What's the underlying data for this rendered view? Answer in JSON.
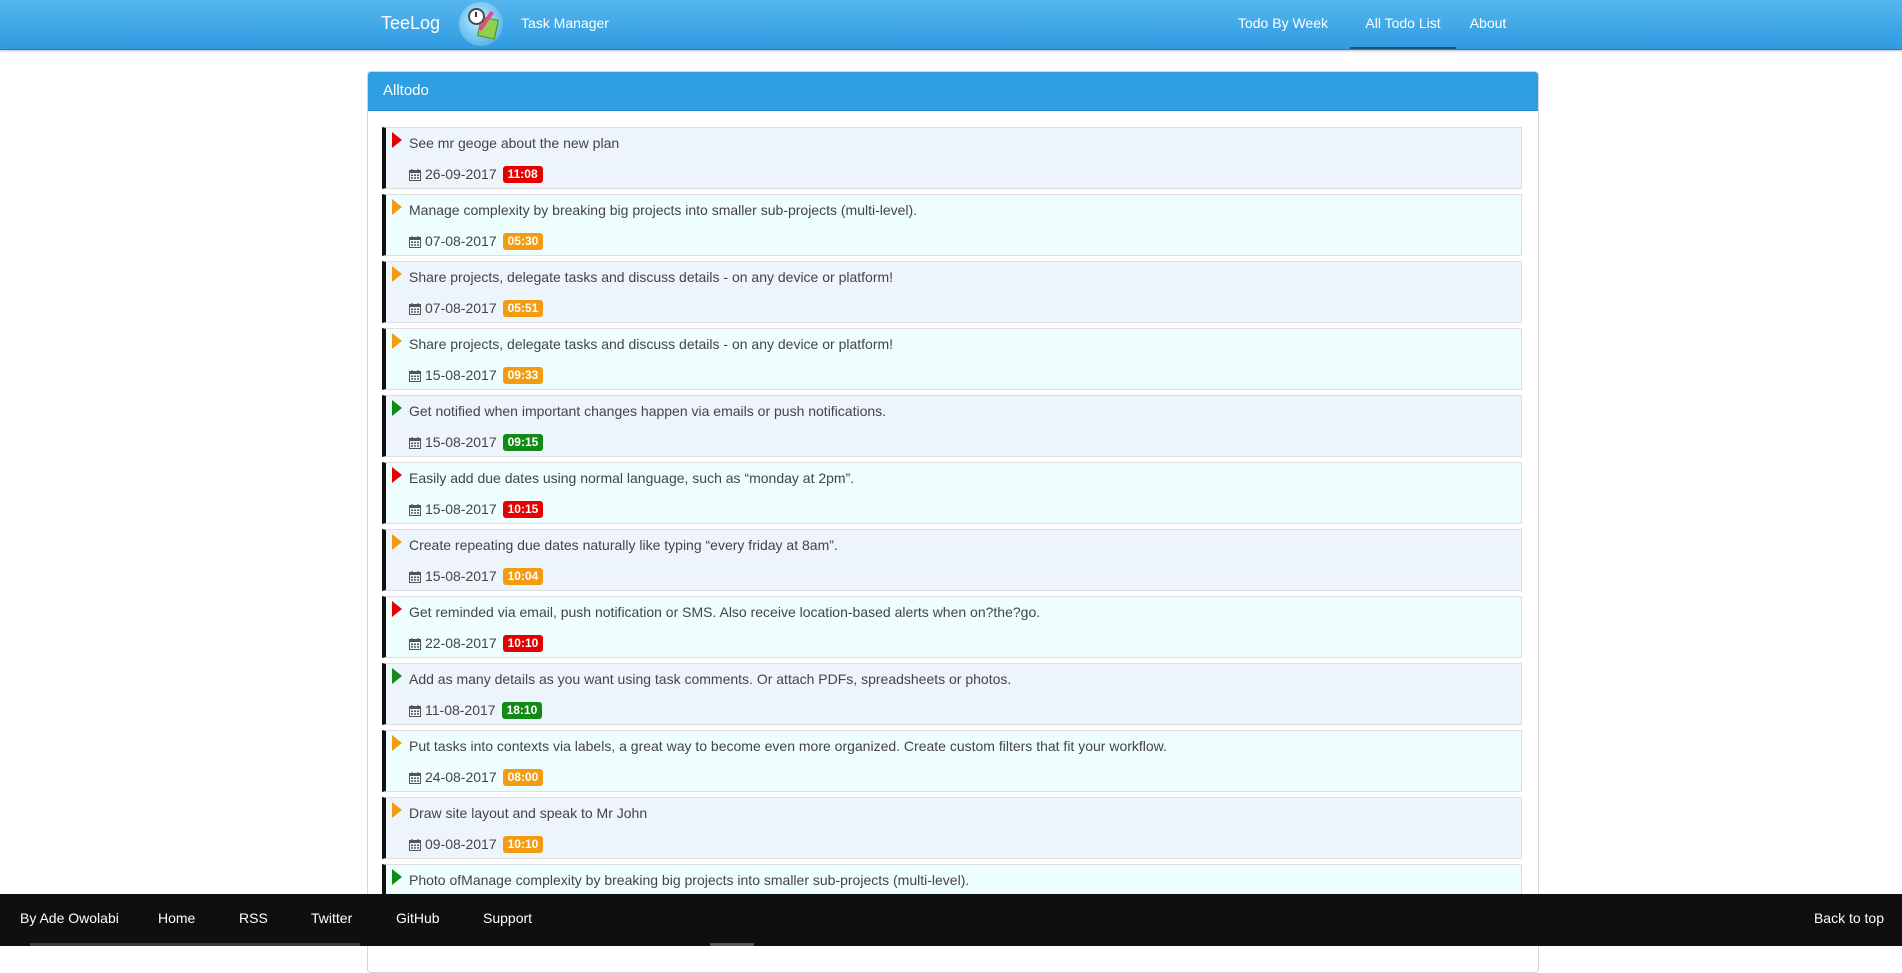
{
  "navbar": {
    "brand": "TeeLog",
    "subtitle": "Task Manager",
    "links": [
      "Todo By Week",
      "All Todo List",
      "About"
    ],
    "active": "All Todo List"
  },
  "panel": {
    "title": "Alltodo"
  },
  "colors": {
    "red": "#e60000",
    "orange": "#f39c12",
    "green": "#118a16",
    "header_blue": "#2e9fe3"
  },
  "todos": [
    {
      "text": "See mr geoge about the new plan",
      "date": "26-09-2017",
      "time": "11:08",
      "priority": "red"
    },
    {
      "text": "Manage complexity by breaking big projects into smaller sub-projects (multi-level).",
      "date": "07-08-2017",
      "time": "05:30",
      "priority": "orange"
    },
    {
      "text": "Share projects, delegate tasks and discuss details - on any device or platform!",
      "date": "07-08-2017",
      "time": "05:51",
      "priority": "orange"
    },
    {
      "text": "Share projects, delegate tasks and discuss details - on any device or platform!",
      "date": "15-08-2017",
      "time": "09:33",
      "priority": "orange"
    },
    {
      "text": "Get notified when important changes happen via emails or push notifications.",
      "date": "15-08-2017",
      "time": "09:15",
      "priority": "green"
    },
    {
      "text": "Easily add due dates using normal language, such as “monday at 2pm”.",
      "date": "15-08-2017",
      "time": "10:15",
      "priority": "red"
    },
    {
      "text": "Create repeating due dates naturally like typing “every friday at 8am”.",
      "date": "15-08-2017",
      "time": "10:04",
      "priority": "orange"
    },
    {
      "text": "Get reminded via email, push notification or SMS. Also receive location-based alerts when on?the?go.",
      "date": "22-08-2017",
      "time": "10:10",
      "priority": "red"
    },
    {
      "text": "Add as many details as you want using task comments. Or attach PDFs, spreadsheets or photos.",
      "date": "11-08-2017",
      "time": "18:10",
      "priority": "green"
    },
    {
      "text": "Put tasks into contexts via labels, a great way to become even more organized. Create custom filters that fit your workflow.",
      "date": "24-08-2017",
      "time": "08:00",
      "priority": "orange"
    },
    {
      "text": "Draw site layout and speak to Mr John",
      "date": "09-08-2017",
      "time": "10:10",
      "priority": "orange"
    },
    {
      "text": "Photo ofManage complexity by breaking big projects into smaller sub-projects (multi-level).",
      "date": "",
      "time": "",
      "priority": "green"
    }
  ],
  "footer": {
    "author": "By Ade Owolabi",
    "links": [
      "Home",
      "RSS",
      "Twitter",
      "GitHub",
      "Support"
    ],
    "back_to_top": "Back to top"
  }
}
